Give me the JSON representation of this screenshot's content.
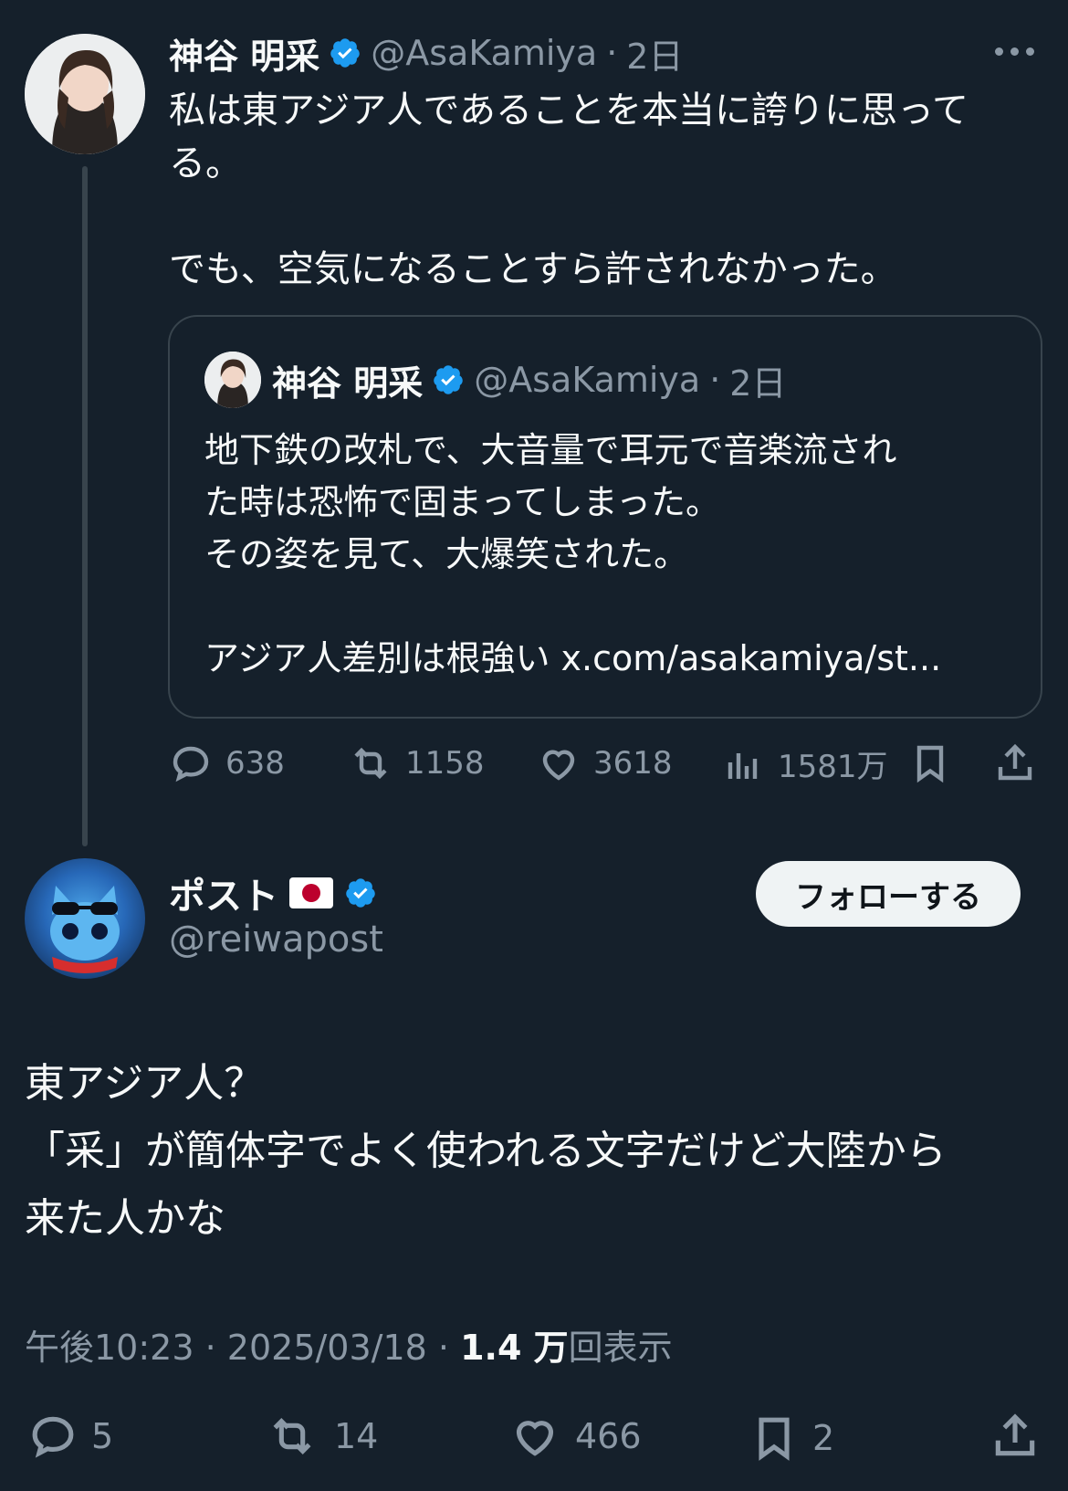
{
  "parent_tweet": {
    "author_name": "神谷 明采",
    "author_handle": "@AsaKamiya",
    "time_ago": "2日",
    "separator": "·",
    "text": "私は東アジア人であることを本当に誇りに思って\nる。\n\nでも、空気になることすら許されなかった。",
    "quote": {
      "author_name": "神谷 明采",
      "author_handle": "@AsaKamiya",
      "time_ago": "2日",
      "text": "地下鉄の改札で、大音量で耳元で音楽流され\nた時は恐怖で固まってしまった。\nその姿を見て、大爆笑された。\n\nアジア人差別は根強い x.com/asakamiya/st..."
    },
    "actions": {
      "replies": "638",
      "retweets": "1158",
      "likes": "3618",
      "views": "1581万"
    }
  },
  "reply_tweet": {
    "author_name": "ポスト",
    "author_handle": "@reiwapost",
    "follow_label": "フォローする",
    "text": "東アジア人？\n「采」が簡体字でよく使われる文字だけど大陸から\n来た人かな",
    "meta": {
      "time": "午後10:23",
      "date": "2025/03/18",
      "views_count": "1.4 万",
      "views_label": "回表示"
    },
    "actions": {
      "replies": "5",
      "retweets": "14",
      "likes": "466",
      "bookmarks": "2"
    }
  },
  "colors": {
    "background": "#15202b",
    "verified": "#1d9bf0",
    "muted": "#8b98a5",
    "border": "#38444d"
  },
  "icons": [
    "more-icon",
    "verified-icon",
    "reply-icon",
    "retweet-icon",
    "like-icon",
    "views-icon",
    "bookmark-icon",
    "share-icon",
    "japan-flag-icon"
  ]
}
